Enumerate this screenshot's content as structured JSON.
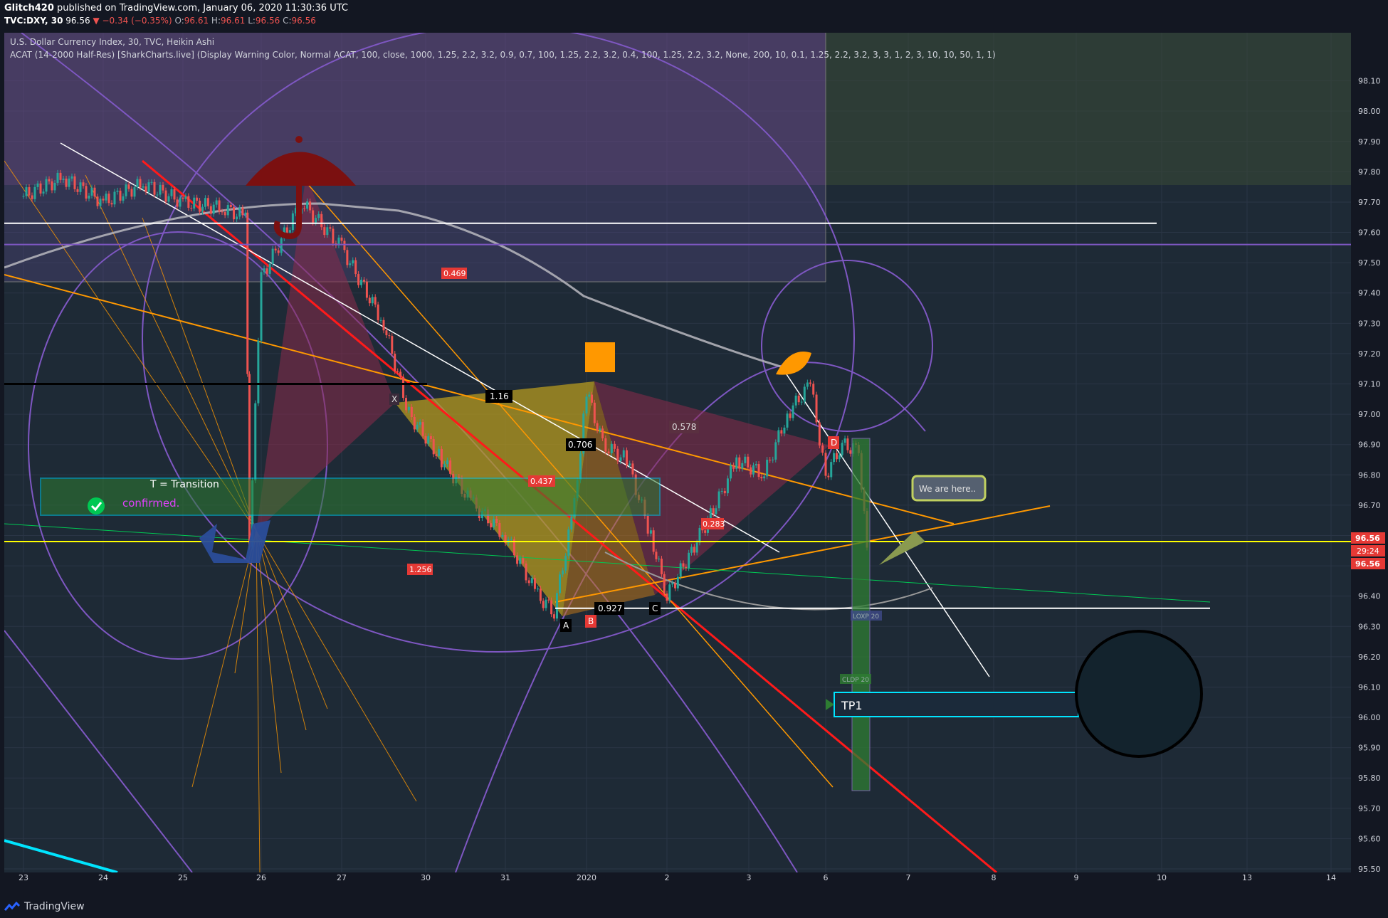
{
  "header": {
    "author": "Glitch420",
    "published": "published on TradingView.com, January 06, 2020 11:30:36 UTC",
    "symbol": "TVC:DXY, 30",
    "last": "96.56",
    "change": "▼ −0.34 (−0.35%)",
    "ohlc": [
      {
        "k": "O:",
        "v": "96.61"
      },
      {
        "k": "H:",
        "v": "96.61"
      },
      {
        "k": "L:",
        "v": "96.56"
      },
      {
        "k": "C:",
        "v": "96.56"
      }
    ]
  },
  "legend": {
    "line1": "U.S. Dollar Currency Index, 30, TVC, Heikin Ashi",
    "line2": "ACAT (14-2000 Half-Res) [SharkCharts.live] (Display Warning Color, Normal ACAT, 100, close, 1000, 1.25, 2.2, 3.2, 0.9, 0.7, 100, 1.25, 2.2, 3.2, 0.4, 100, 1.25, 2.2, 3.2, None, 200, 10, 0.1, 1.25, 2.2, 3.2, 3, 3, 1, 2, 3, 10, 10, 50, 1, 1)"
  },
  "footer": {
    "brand": "TradingView"
  },
  "chart_data": {
    "type": "line",
    "title": "U.S. Dollar Currency Index, 30, TVC, Heikin Ashi",
    "ylim": [
      95.5,
      98.2
    ],
    "y_ticks": [
      "98.10",
      "98.00",
      "97.90",
      "97.80",
      "97.70",
      "97.60",
      "97.50",
      "97.40",
      "97.30",
      "97.20",
      "97.10",
      "97.00",
      "96.90",
      "96.80",
      "96.70",
      "96.60",
      "96.50",
      "96.40",
      "96.30",
      "96.20",
      "96.10",
      "96.00",
      "95.90",
      "95.80",
      "95.70",
      "95.60",
      "95.50"
    ],
    "x_ticks": [
      "23",
      "24",
      "25",
      "26",
      "27",
      "30",
      "31",
      "2020",
      "2",
      "3",
      "6",
      "7",
      "8",
      "9",
      "10",
      "13",
      "14"
    ],
    "price_labels": {
      "last": "96.56",
      "countdown": "29:24",
      "close": "96.56"
    },
    "series": [
      {
        "name": "Heikin Ashi close",
        "x": [
          0.0,
          0.5,
          1.0,
          1.5,
          2.0,
          2.5,
          2.8,
          2.85,
          3.0,
          3.5,
          4.0,
          4.5,
          4.8,
          5.2,
          5.6,
          6.0,
          6.4,
          6.6,
          6.85,
          7.0,
          7.2,
          7.5,
          7.8,
          8.0,
          8.3,
          8.6,
          8.85,
          9.2,
          9.5,
          9.8,
          10.0,
          10.2,
          10.4,
          10.5
        ],
        "values": [
          97.72,
          97.78,
          97.7,
          97.76,
          97.7,
          97.68,
          97.65,
          96.58,
          97.45,
          97.7,
          97.55,
          97.3,
          97.0,
          96.85,
          96.7,
          96.6,
          96.4,
          96.35,
          96.7,
          97.08,
          96.9,
          96.85,
          96.6,
          96.4,
          96.55,
          96.7,
          96.85,
          96.8,
          97.0,
          97.1,
          96.8,
          96.9,
          96.88,
          96.56
        ]
      }
    ],
    "horizontal_levels": [
      {
        "name": "resistance",
        "y": 97.63,
        "color": "#ffffff"
      },
      {
        "name": "range",
        "y": 97.56,
        "color": "#7e57c2"
      },
      {
        "name": "level",
        "y": 97.1,
        "color": "#000000"
      },
      {
        "name": "current",
        "y": 96.58,
        "color": "#ffff00"
      },
      {
        "name": "low",
        "y": 96.36,
        "color": "#ffffff"
      }
    ],
    "pattern_labels": {
      "X": "X",
      "A": "A",
      "B": "B",
      "C": "C",
      "D": "D",
      "r1": "1.16",
      "r2": "0.706",
      "r3": "0.578",
      "r4": "0.437",
      "r5": "0.469",
      "r6": "1.256",
      "r7": "0.927",
      "r8": "0.283"
    },
    "annotations": {
      "transition": "T = Transition",
      "confirmed": "confirmed.",
      "we_are_here": "We are here..",
      "tp1": "TP1",
      "loxp": "LOXP 20",
      "cldp": "CLDP 20"
    },
    "colors": {
      "bull": "#26a69a",
      "bear": "#ef5350",
      "bg": "#1e2a36",
      "purple": "#7e57c2",
      "orange": "#ff9800",
      "red": "#ff1a1a",
      "cyan": "#00e5ff"
    }
  }
}
